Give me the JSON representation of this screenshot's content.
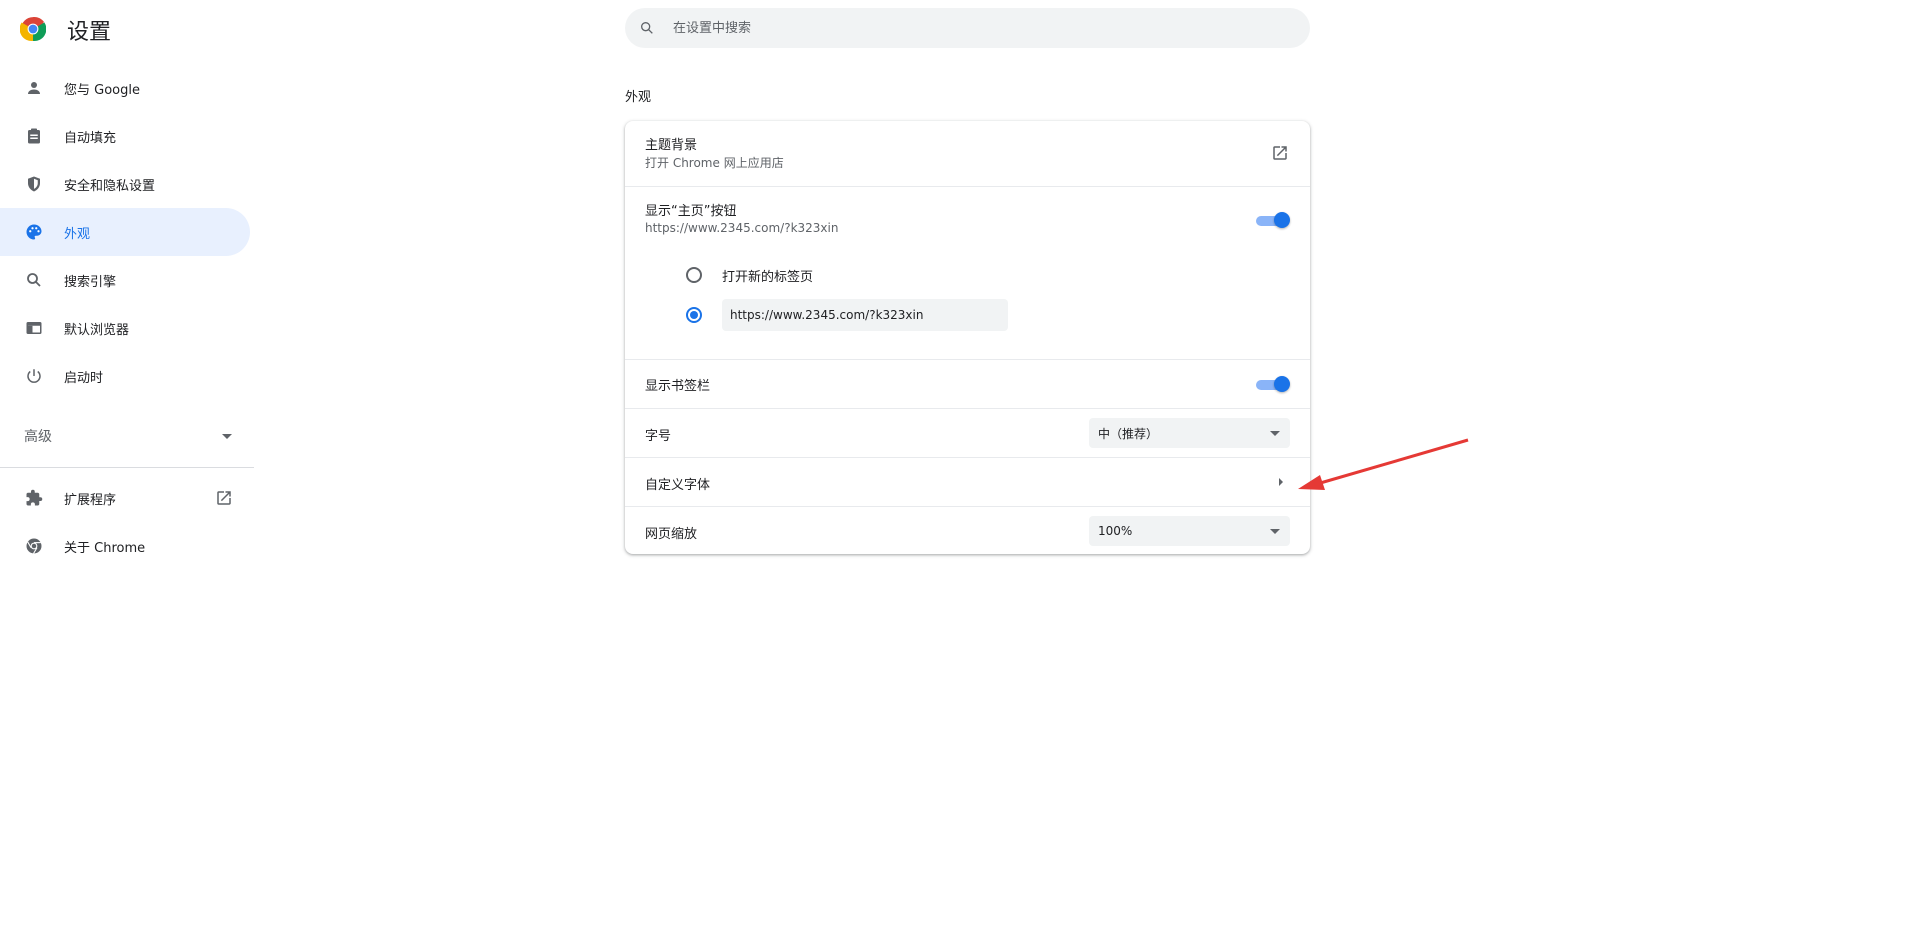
{
  "app": {
    "title": "设置"
  },
  "search": {
    "placeholder": "在设置中搜索"
  },
  "sidebar": {
    "items": [
      {
        "label": "您与 Google",
        "icon": "person-icon"
      },
      {
        "label": "自动填充",
        "icon": "clipboard-icon"
      },
      {
        "label": "安全和隐私设置",
        "icon": "shield-icon"
      },
      {
        "label": "外观",
        "icon": "palette-icon",
        "active": true
      },
      {
        "label": "搜索引擎",
        "icon": "search-icon"
      },
      {
        "label": "默认浏览器",
        "icon": "browser-icon"
      },
      {
        "label": "启动时",
        "icon": "power-icon"
      }
    ],
    "advanced_label": "高级",
    "bottom": [
      {
        "label": "扩展程序",
        "icon": "puzzle-icon"
      },
      {
        "label": "关于 Chrome",
        "icon": "chrome-icon"
      }
    ]
  },
  "appearance": {
    "section_title": "外观",
    "theme": {
      "title": "主题背景",
      "subtitle": "打开 Chrome 网上应用店"
    },
    "home_button": {
      "title": "显示“主页”按钮",
      "subtitle": "https://www.2345.com/?k323xin",
      "enabled": true,
      "option_new_tab": "打开新的标签页",
      "custom_url": "https://www.2345.com/?k323xin"
    },
    "bookmarks_bar": {
      "title": "显示书签栏",
      "enabled": true
    },
    "font_size": {
      "title": "字号",
      "value": "中（推荐）"
    },
    "custom_fonts": {
      "title": "自定义字体"
    },
    "page_zoom": {
      "title": "网页缩放",
      "value": "100%"
    }
  },
  "colors": {
    "accent": "#1a73e8",
    "active_bg": "#e8f0fe",
    "annotation": "#e53935"
  }
}
